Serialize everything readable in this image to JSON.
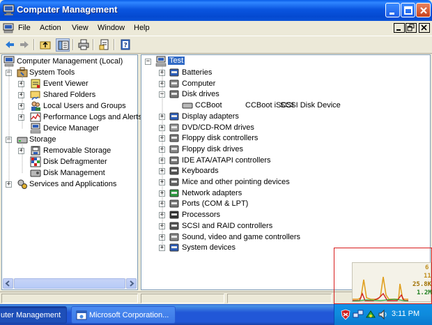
{
  "window": {
    "title": "Computer Management"
  },
  "menu": {
    "items": [
      "File",
      "Action",
      "View",
      "Window",
      "Help"
    ]
  },
  "toolbar": {
    "buttons": [
      "back",
      "forward",
      "up-one-level",
      "show-hide-console-tree",
      "print",
      "properties",
      "help"
    ]
  },
  "left_tree": {
    "root": "Computer Management (Local)",
    "system_tools": "System Tools",
    "event_viewer": "Event Viewer",
    "shared_folders": "Shared Folders",
    "local_users": "Local Users and Groups",
    "perf_logs": "Performance Logs and Alerts",
    "device_manager": "Device Manager",
    "storage": "Storage",
    "removable_storage": "Removable Storage",
    "disk_defrag": "Disk Defragmenter",
    "disk_mgmt": "Disk Management",
    "services": "Services and Applications"
  },
  "device_tree": {
    "root": "Test",
    "categories": [
      "Batteries",
      "Computer",
      "Disk drives",
      "Display adapters",
      "DVD/CD-ROM drives",
      "Floppy disk controllers",
      "Floppy disk drives",
      "IDE ATA/ATAPI controllers",
      "Keyboards",
      "Mice and other pointing devices",
      "Network adapters",
      "Ports (COM & LPT)",
      "Processors",
      "SCSI and RAID controllers",
      "Sound, video and game controllers",
      "System devices"
    ],
    "disk_drives_children": [
      "CCBoot",
      "CCBoot iSCSI",
      "SCSI Disk Device"
    ]
  },
  "monitor": {
    "values": [
      "6",
      "11",
      "25.8K",
      "1.2M"
    ]
  },
  "taskbar": {
    "buttons": [
      "uter Management",
      "Microsoft Corporation..."
    ],
    "clock": "3:11 PM"
  },
  "colors": {
    "selection": "#316ac5",
    "titlebar": "#0a55e0",
    "taskbar": "#2157d7"
  }
}
